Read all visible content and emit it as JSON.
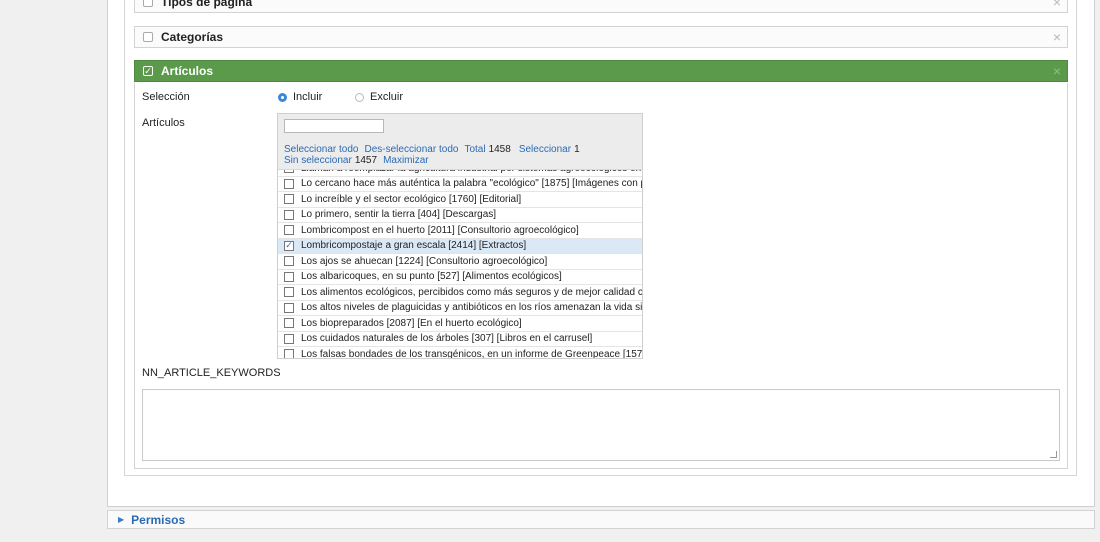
{
  "sections": {
    "tipos_title": "Tipos de página",
    "categorias_title": "Categorías",
    "articulos_title": "Artículos",
    "close_glyph": "×"
  },
  "articulos": {
    "seleccion_label": "Selección",
    "incluir_label": "Incluir",
    "excluir_label": "Excluir",
    "articulos_label": "Artículos",
    "selected_mode": "Incluir"
  },
  "picker": {
    "search_value": "",
    "select_all": "Seleccionar todo",
    "deselect_all": "Des-seleccionar todo",
    "total_label": "Total",
    "total_value": "1458",
    "selected_label": "Seleccionar",
    "selected_value": "1",
    "unselected_label": "Sin seleccionar",
    "unselected_value": "1457",
    "maximize": "Maximizar",
    "items": [
      {
        "text": "Llaman a reemplazar la agricultura industrial por sistemas agroecológicos en",
        "checked": false
      },
      {
        "text": "Lo cercano hace más auténtica la palabra \"ecológico\" [1875] [Imágenes con p",
        "checked": false
      },
      {
        "text": "Lo increíble y el sector ecológico [1760] [Editorial]",
        "checked": false
      },
      {
        "text": "Lo primero, sentir la tierra [404] [Descargas]",
        "checked": false
      },
      {
        "text": "Lombricompost en el huerto [2011] [Consultorio agroecológico]",
        "checked": false
      },
      {
        "text": "Lombricompostaje a gran escala [2414] [Extractos]",
        "checked": true
      },
      {
        "text": "Los ajos se ahuecan [1224] [Consultorio agroecológico]",
        "checked": false
      },
      {
        "text": "Los albaricoques, en su punto [527] [Alimentos ecológicos]",
        "checked": false
      },
      {
        "text": "Los alimentos ecológicos, percibidos como más seguros y de mejor calidad c",
        "checked": false
      },
      {
        "text": "Los altos niveles de plaguicidas y antibióticos en los ríos amenazan la vida si",
        "checked": false
      },
      {
        "text": "Los biopreparados [2087] [En el huerto ecológico]",
        "checked": false
      },
      {
        "text": "Los cuidados naturales de los árboles [307] [Libros en el carrusel]",
        "checked": false
      },
      {
        "text": "Los falsas bondades de los transgénicos, en un informe de Greenpeace [157",
        "checked": false
      }
    ]
  },
  "keywords": {
    "label": "NN_ARTICLE_KEYWORDS",
    "value": ""
  },
  "permisos": {
    "title": "Permisos"
  },
  "colors": {
    "accent_green": "#5a9a4a",
    "link_blue": "#2a6ab4",
    "selected_row": "#dbe9f7"
  }
}
